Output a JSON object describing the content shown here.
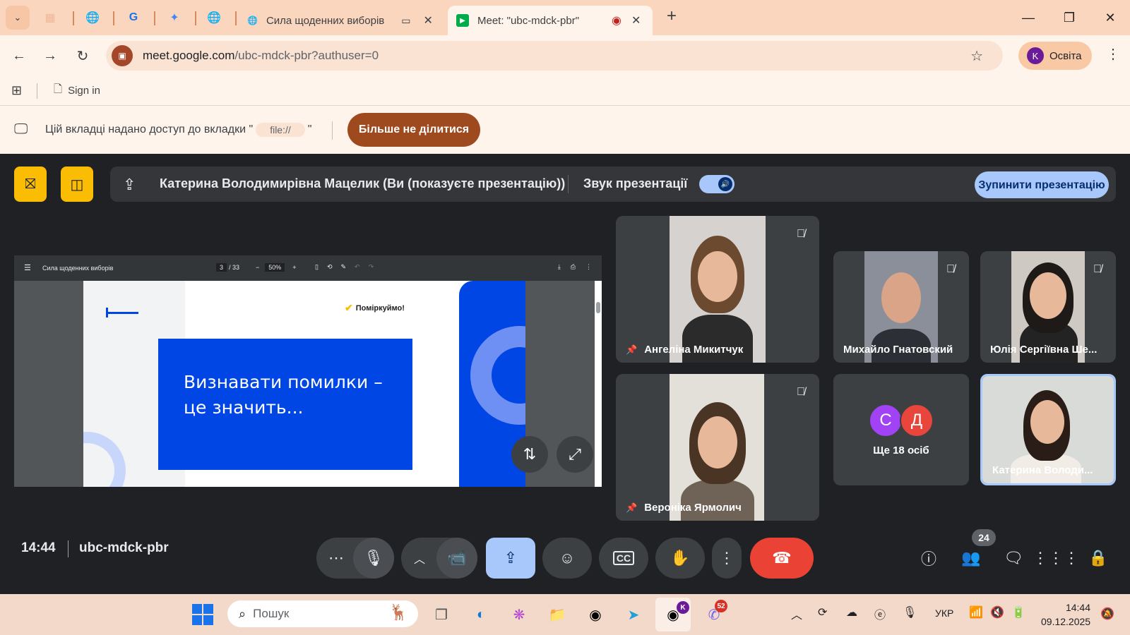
{
  "browser": {
    "tabs": [
      {
        "title": "Сила щоденних виборів"
      },
      {
        "title": "Meet: \"ubc-mdck-pbr\"",
        "active": true
      }
    ],
    "new_tab": "+",
    "url_host": "meet.google.com",
    "url_path": "/ubc-mdck-pbr?authuser=0",
    "profile_initial": "K",
    "profile_name": "Освіта",
    "bookmark_signin": "Sign in"
  },
  "share_notice": {
    "text_before": "Цій вкладці надано доступ до вкладки \"",
    "tab_name": "file://",
    "text_after": "\"",
    "stop_button": "Більше не ділитися"
  },
  "meet": {
    "presenter_text": "Катерина Володимирівна Мацелик (Ви (показуєте презентацію))",
    "presentation_audio_label": "Звук презентації",
    "presentation_audio_on": true,
    "stop_presenting_button": "Зупинити презентацію",
    "time": "14:44",
    "meeting_code": "ubc-mdck-pbr",
    "participants_count": "24",
    "accent_red": "#ea4335",
    "accent_blue": "#a8c7fa"
  },
  "pdf": {
    "title": "Сила щоденних виборів",
    "page_current": "3",
    "page_total": "/ 33",
    "zoom": "50%",
    "slide_logo": "Поміркуймо!",
    "slide_text": "Визнавати помилки – це значить..."
  },
  "participants": [
    {
      "name": "Ангеліна Микитчук",
      "pinned": true,
      "muted": true
    },
    {
      "name": "Михайло Гнатовский",
      "pinned": false,
      "muted": true
    },
    {
      "name": "Юлія Сергіївна Ше...",
      "pinned": false,
      "muted": true
    },
    {
      "name": "Вероніка Ярмолич",
      "pinned": true,
      "muted": true
    },
    {
      "name": "Катерина Володи...",
      "pinned": false,
      "muted": false
    }
  ],
  "others": {
    "avatars": [
      {
        "letter": "С",
        "color": "#a142f4"
      },
      {
        "letter": "Д",
        "color": "#e8453c"
      }
    ],
    "label": "Ще 18 осіб"
  },
  "taskbar": {
    "search_placeholder": "Пошук",
    "chrome_badge": "K",
    "viber_badge": "52",
    "language": "УКР",
    "time": "14:44",
    "date": "09.12.2025"
  }
}
